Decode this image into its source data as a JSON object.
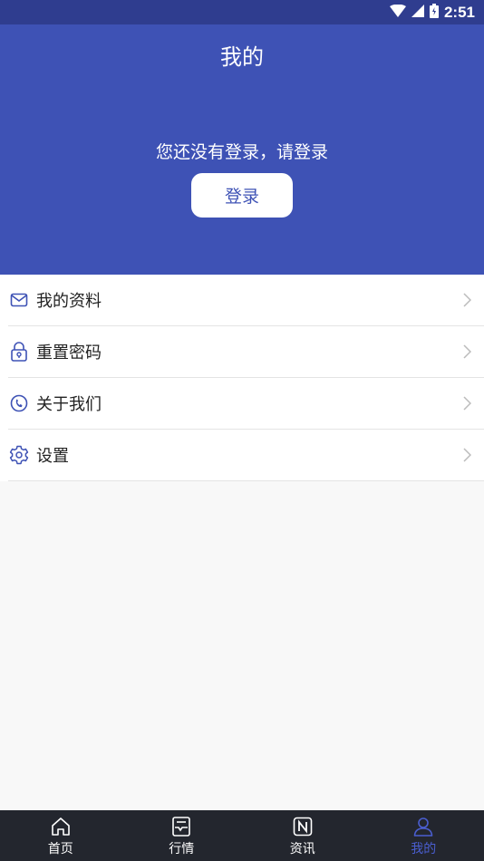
{
  "status_bar": {
    "time": "2:51"
  },
  "header": {
    "title": "我的",
    "login_prompt": "您还没有登录，请登录",
    "login_button": "登录"
  },
  "menu": {
    "items": [
      {
        "label": "我的资料",
        "icon": "mail-icon"
      },
      {
        "label": "重置密码",
        "icon": "lock-icon"
      },
      {
        "label": "关于我们",
        "icon": "phone-icon"
      },
      {
        "label": "设置",
        "icon": "gear-icon"
      }
    ]
  },
  "tabbar": {
    "tabs": [
      {
        "label": "首页",
        "icon": "home-icon"
      },
      {
        "label": "行情",
        "icon": "market-icon"
      },
      {
        "label": "资讯",
        "icon": "news-icon"
      },
      {
        "label": "我的",
        "icon": "user-icon"
      }
    ],
    "active_index": 3
  },
  "colors": {
    "header_bg": "#3e52b5",
    "statusbar_bg": "#2f3d8f",
    "accent": "#4a5ed0",
    "tabbar_bg": "#23262e"
  }
}
